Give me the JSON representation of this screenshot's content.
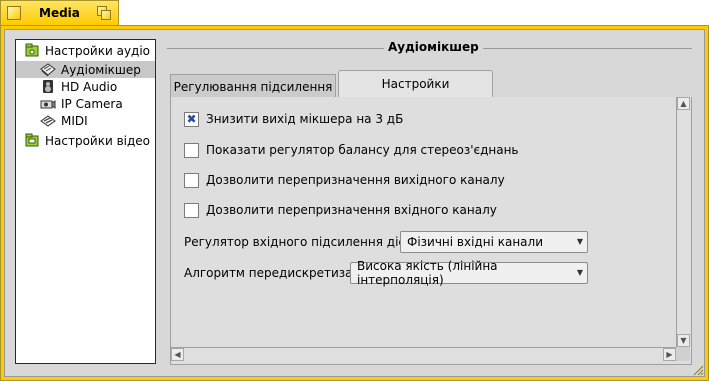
{
  "window": {
    "title": "Media"
  },
  "tree": {
    "items": [
      {
        "label": "Настройки аудіо",
        "icon": "folder-audio-icon",
        "level": 0,
        "selected": false
      },
      {
        "label": "Аудіомікшер",
        "icon": "mixer-icon",
        "level": 1,
        "selected": true
      },
      {
        "label": "HD Audio",
        "icon": "speaker-icon",
        "level": 1,
        "selected": false
      },
      {
        "label": "IP Camera",
        "icon": "camera-icon",
        "level": 1,
        "selected": false
      },
      {
        "label": "MIDI",
        "icon": "midi-icon",
        "level": 1,
        "selected": false
      },
      {
        "label": "Настройки відео",
        "icon": "folder-video-icon",
        "level": 0,
        "selected": false
      }
    ]
  },
  "section": {
    "title": "Аудіомікшер"
  },
  "tabs": [
    {
      "label": "Регулювання підсилення",
      "active": false
    },
    {
      "label": "Настройки",
      "active": true
    }
  ],
  "options": {
    "checkboxes": [
      {
        "label": "Знизити вихід мікшера на 3 дБ",
        "checked": true
      },
      {
        "label": "Показати регулятор балансу для стереоз'єднань",
        "checked": false
      },
      {
        "label": "Дозволити перепризначення вихідного каналу",
        "checked": false
      },
      {
        "label": "Дозволити перепризначення вхідного каналу",
        "checked": false
      }
    ],
    "input_gain": {
      "label": "Регулятор вхідного підсилення діє на:",
      "value": "Фізичні вхідні канали"
    },
    "resampling": {
      "label": "Алгоритм передискретизації:",
      "value": "Висока якість (лінійна інтерполяція)"
    }
  },
  "colors": {
    "tab_yellow": "#ffcb00",
    "panel_gray": "#d8d8d8",
    "tree_border": "#1b1b99",
    "check_mark": "#2a4d9c"
  }
}
